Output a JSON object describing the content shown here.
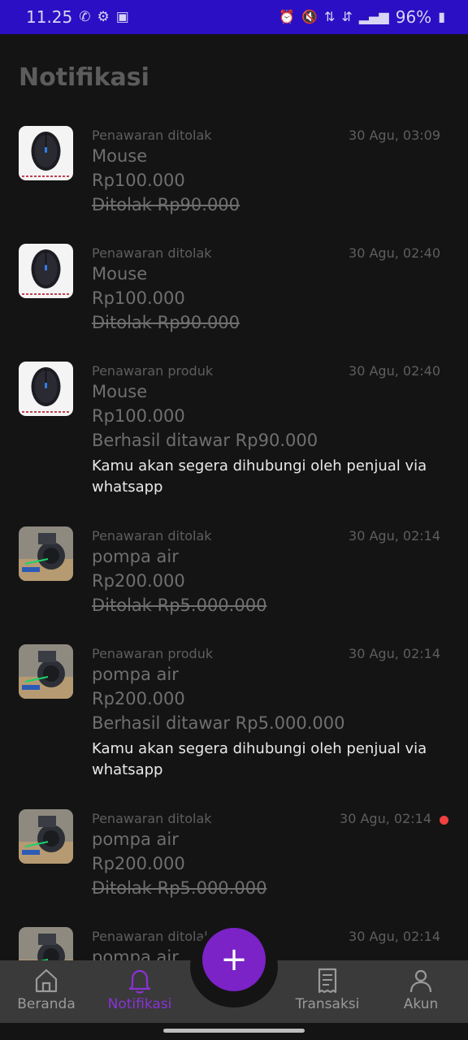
{
  "status_bar": {
    "time": "11.25",
    "battery": "96%",
    "left_icons": [
      "whatsapp-icon",
      "settings-icon",
      "linkedin-icon"
    ],
    "right_icons": [
      "alarm-icon",
      "mute-icon",
      "volte-icon",
      "4g-icon",
      "signal-icon",
      "battery-icon"
    ]
  },
  "page": {
    "title": "Notifikasi"
  },
  "notifications": [
    {
      "kind": "Penawaran ditolak",
      "time": "30 Agu, 03:09",
      "product": "Mouse",
      "price": "Rp100.000",
      "offer": "Ditolak Rp90.000",
      "offer_struck": true,
      "note": "",
      "unread": false,
      "thumb": "mouse"
    },
    {
      "kind": "Penawaran ditolak",
      "time": "30 Agu, 02:40",
      "product": "Mouse",
      "price": "Rp100.000",
      "offer": "Ditolak Rp90.000",
      "offer_struck": true,
      "note": "",
      "unread": false,
      "thumb": "mouse"
    },
    {
      "kind": "Penawaran produk",
      "time": "30 Agu, 02:40",
      "product": "Mouse",
      "price": "Rp100.000",
      "offer": "Berhasil ditawar Rp90.000",
      "offer_struck": false,
      "note": "Kamu akan segera dihubungi oleh penjual via whatsapp",
      "unread": false,
      "thumb": "mouse"
    },
    {
      "kind": "Penawaran ditolak",
      "time": "30 Agu, 02:14",
      "product": "pompa air",
      "price": "Rp200.000",
      "offer": "Ditolak Rp5.000.000",
      "offer_struck": true,
      "note": "",
      "unread": false,
      "thumb": "pump"
    },
    {
      "kind": "Penawaran produk",
      "time": "30 Agu, 02:14",
      "product": "pompa air",
      "price": "Rp200.000",
      "offer": "Berhasil ditawar Rp5.000.000",
      "offer_struck": false,
      "note": "Kamu akan segera dihubungi oleh penjual via whatsapp",
      "unread": false,
      "thumb": "pump"
    },
    {
      "kind": "Penawaran ditolak",
      "time": "30 Agu, 02:14",
      "product": "pompa air",
      "price": "Rp200.000",
      "offer": "Ditolak Rp5.000.000",
      "offer_struck": true,
      "note": "",
      "unread": true,
      "thumb": "pump"
    },
    {
      "kind": "Penawaran ditolak",
      "time": "30 Agu, 02:14",
      "product": "pompa air",
      "price": "",
      "offer": "",
      "offer_struck": true,
      "note": "",
      "unread": false,
      "thumb": "pump"
    }
  ],
  "bottom_nav": {
    "items": [
      {
        "label": "Beranda",
        "icon": "home-icon",
        "active": false
      },
      {
        "label": "Notifikasi",
        "icon": "bell-icon",
        "active": true
      },
      {
        "label": "Transaksi",
        "icon": "receipt-icon",
        "active": false
      },
      {
        "label": "Akun",
        "icon": "user-icon",
        "active": false
      }
    ],
    "fab_icon": "plus-icon",
    "fab_label": "+"
  },
  "colors": {
    "accent": "#7b23c6",
    "status_bar": "#2a0fc4",
    "unread_dot": "#f24040",
    "background": "#141414"
  }
}
